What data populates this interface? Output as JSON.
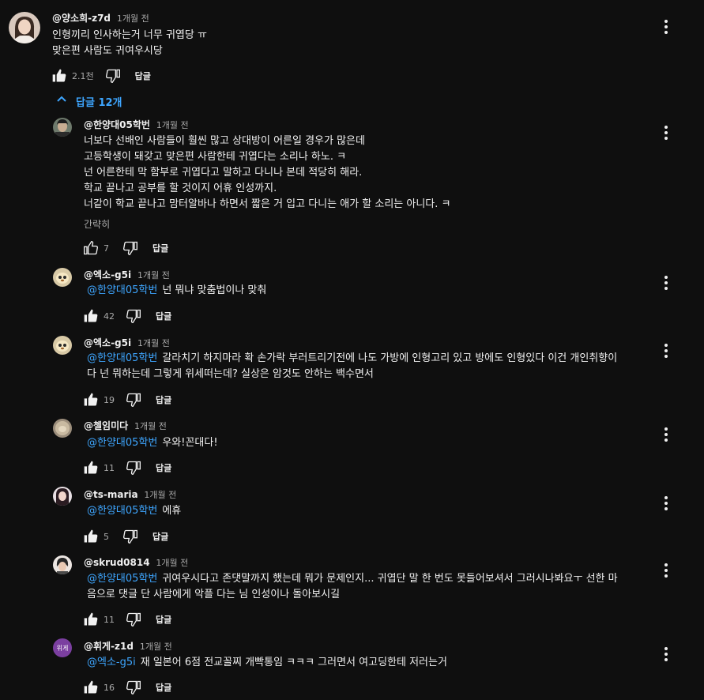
{
  "main_comment": {
    "author": "@양소희-z7d",
    "time": "1개월 전",
    "lines": [
      "인형끼리 인사하는거 너무 귀엽당 ㅠ",
      "맞은편 사람도 귀여우시당"
    ],
    "likes": "2.1천",
    "reply_label": "답글",
    "replies_toggle": "답글 12개"
  },
  "replies": [
    {
      "author": "@한양대05학번",
      "time": "1개월 전",
      "mention": "",
      "lines": [
        "너보다 선배인 사람들이 훨씬 많고 상대방이 어른일 경우가 많은데",
        "고등학생이 돼갖고 맞은편 사람한테 귀엽다는 소리나 하노. ㅋ",
        "넌 어른한테 막 함부로 귀엽다고 말하고 다니나 본데 적당히 해라.",
        "학교 끝나고 공부를 할 것이지 어휴 인성까지.",
        "너같이 학교 끝나고 맘터알바나 하면서 짧은 거 입고 다니는 애가 할 소리는 아니다. ㅋ"
      ],
      "more": "간략히",
      "likes": "7",
      "reply_label": "답글"
    },
    {
      "author": "@엑소-g5i",
      "time": "1개월 전",
      "mention": "@한양대05학번",
      "lines": [
        "넌 뭐냐 맞춤법이나 맞춰"
      ],
      "likes": "42",
      "reply_label": "답글"
    },
    {
      "author": "@엑소-g5i",
      "time": "1개월 전",
      "mention": "@한양대05학번",
      "lines": [
        "갈라치기 하지마라 확 손가락 부러트리기전에 나도 가방에 인형고리 있고 방에도 인형있다 이건 개인취향이",
        "다 넌 뭐하는데 그렇게 위세떠는데? 실상은 암것도 안하는 백수면서"
      ],
      "likes": "19",
      "reply_label": "답글"
    },
    {
      "author": "@첼임미다",
      "time": "1개월 전",
      "mention": "@한양대05학번",
      "lines": [
        "우와!꼰대다!"
      ],
      "likes": "11",
      "reply_label": "답글"
    },
    {
      "author": "@ts-maria",
      "time": "1개월 전",
      "mention": "@한양대05학번",
      "lines": [
        "에휴"
      ],
      "likes": "5",
      "reply_label": "답글"
    },
    {
      "author": "@skrud0814",
      "time": "1개월 전",
      "mention": "@한양대05학번",
      "lines": [
        "귀여우시다고 존댓말까지 했는데 뭐가 문제인지... 귀엽단 말 한 번도 못들어보셔서 그러시나봐요ㅜ 선한 마",
        "음으로 댓글 단 사람에게 악플 다는 님 인성이나 돌아보시길"
      ],
      "likes": "11",
      "reply_label": "답글"
    },
    {
      "author": "@휘게-z1d",
      "time": "1개월 전",
      "mention": "@엑소-g5i",
      "avatar_text": "위게",
      "lines": [
        "재 일본어 6점 전교꼴찌 개빡통임 ㅋㅋㅋ 그러면서 여고딩한테 저러는거"
      ],
      "likes": "16",
      "reply_label": "답글"
    }
  ],
  "colors": {
    "background": "#0f0f0f",
    "text": "#f1f1f1",
    "secondary": "#aaaaaa",
    "link": "#3ea6ff",
    "avatar_purple": "#7b3fa0"
  }
}
